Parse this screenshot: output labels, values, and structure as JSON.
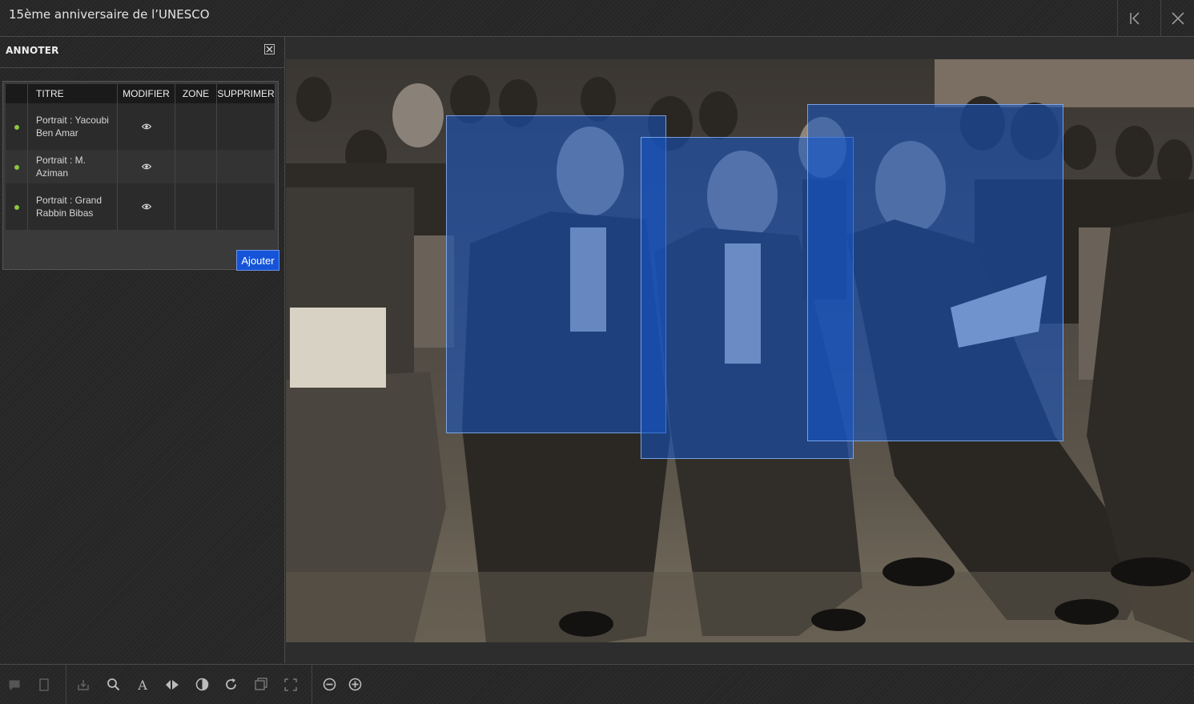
{
  "window": {
    "title": "15ème anniversaire de l’UNESCO"
  },
  "sidebar": {
    "title": "ANNOTER",
    "table": {
      "headers": {
        "titre": "TITRE",
        "modifier": "MODIFIER",
        "zone": "ZONE",
        "supprimer": "SUPPRIMER"
      },
      "rows": [
        {
          "titre": "Portrait : Yacoubi Ben Amar",
          "status_color": "#8cc63f"
        },
        {
          "titre": "Portrait : M. Aziman",
          "status_color": "#8cc63f"
        },
        {
          "titre": "Portrait : Grand Rabbin Bibas",
          "status_color": "#8cc63f"
        }
      ]
    },
    "add_button": "Ajouter"
  },
  "viewer": {
    "image_description": "Black and white photograph of audience seated in theater",
    "zone_color": "#1455c8"
  },
  "toolbar": {
    "icons": [
      "comment-icon",
      "page-icon",
      "download-icon",
      "search-icon",
      "text-icon",
      "adjust-icon",
      "contrast-icon",
      "rotate-icon",
      "copy-icon",
      "fullscreen-icon",
      "zoom-out-icon",
      "zoom-in-icon"
    ]
  }
}
